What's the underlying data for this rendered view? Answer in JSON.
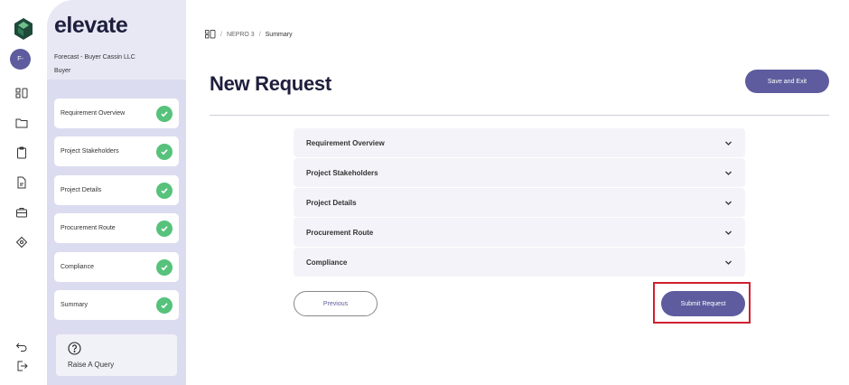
{
  "app": {
    "brand": "elevate",
    "logo_icon": "hexagon-logo-icon",
    "brand_color": "#1e4a3a"
  },
  "user": {
    "avatar_initials": "F-",
    "org_name": "Forecast - Buyer Cassin LLC",
    "role": "Buyer"
  },
  "rail": {
    "icons": [
      "dashboard-icon",
      "folder-icon",
      "clipboard-icon",
      "document-icon",
      "briefcase-icon",
      "tag-icon"
    ],
    "bottom_icons": [
      "undo-icon",
      "logout-icon"
    ]
  },
  "steps": [
    {
      "label": "Requirement Overview",
      "status": "complete"
    },
    {
      "label": "Project Stakeholders",
      "status": "complete"
    },
    {
      "label": "Project Details",
      "status": "complete"
    },
    {
      "label": "Procurement Route",
      "status": "complete"
    },
    {
      "label": "Compliance",
      "status": "complete"
    },
    {
      "label": "Summary",
      "status": "complete"
    }
  ],
  "query": {
    "label": "Raise A Query"
  },
  "breadcrumb": {
    "separator": "/",
    "project": "NEPRO 3",
    "current": "Summary"
  },
  "page": {
    "title": "New Request",
    "save_label": "Save and Exit"
  },
  "sections": [
    {
      "label": "Requirement Overview"
    },
    {
      "label": "Project Stakeholders"
    },
    {
      "label": "Project Details"
    },
    {
      "label": "Procurement Route"
    },
    {
      "label": "Compliance"
    }
  ],
  "actions": {
    "previous_label": "Previous",
    "submit_label": "Submit Request"
  },
  "colors": {
    "accent": "#5e5c9e",
    "success": "#56c27b",
    "highlight": "#d0202e",
    "panel": "#dcdcf0"
  }
}
